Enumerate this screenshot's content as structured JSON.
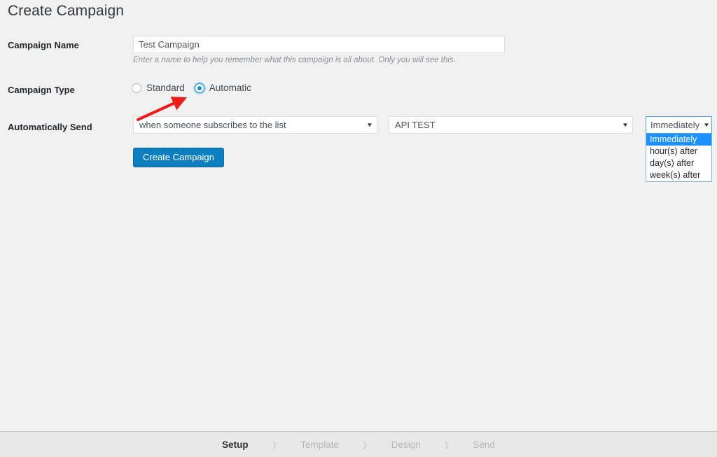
{
  "page": {
    "title": "Create Campaign"
  },
  "form": {
    "campaign_name": {
      "label": "Campaign Name",
      "value": "Test Campaign",
      "placeholder": "",
      "hint": "Enter a name to help you remember what this campaign is all about. Only you will see this."
    },
    "campaign_type": {
      "label": "Campaign Type",
      "options": [
        {
          "label": "Standard",
          "checked": false
        },
        {
          "label": "Automatic",
          "checked": true
        }
      ]
    },
    "automatically_send": {
      "label": "Automatically Send",
      "trigger_select": {
        "value": "when someone subscribes to the list",
        "arrow": "select-arrow-icon"
      },
      "list_select": {
        "value": "API TEST",
        "arrow": "select-arrow-icon"
      },
      "delay_select": {
        "value": "Immediately",
        "arrow": "select-arrow-icon",
        "expanded": true,
        "options": [
          "Immediately",
          "hour(s) after",
          "day(s) after",
          "week(s) after"
        ],
        "selected_index": 0
      }
    },
    "submit_button": {
      "label": "Create Campaign"
    }
  },
  "annotation": {
    "arrow": {
      "name": "red-arrow-annotation",
      "color": "#ef1c1c",
      "points_to": "Automatic radio button"
    }
  },
  "footer": {
    "steps": [
      {
        "label": "Setup",
        "active": true
      },
      {
        "label": "Template",
        "active": false
      },
      {
        "label": "Design",
        "active": false
      },
      {
        "label": "Send",
        "active": false
      }
    ],
    "separator": "›"
  },
  "colors": {
    "background": "#f1f1f1",
    "accent": "#0d7fc0",
    "radio_accent": "#1e8cbe",
    "highlight": "#1e90ff",
    "annotation": "#ef1c1c",
    "footer_bg": "#e8e8e8"
  }
}
